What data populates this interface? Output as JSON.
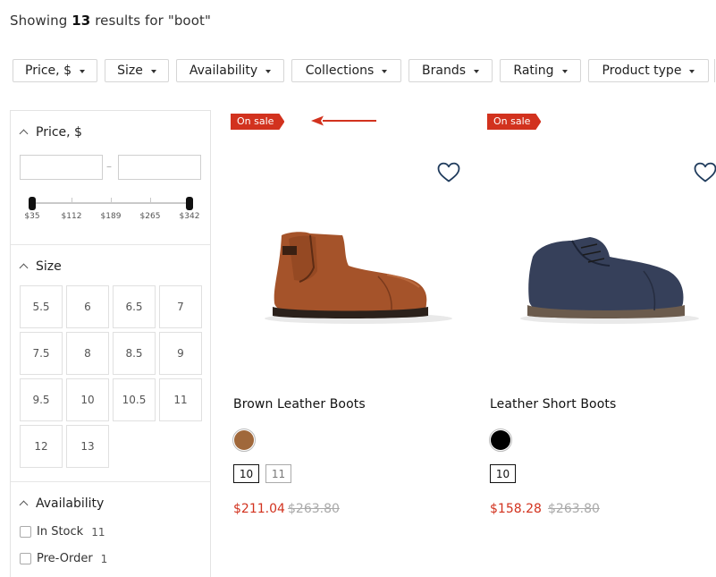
{
  "results": {
    "prefix": "Showing",
    "count": "13",
    "suffix": "results for \"boot\""
  },
  "filters": [
    "Price, $",
    "Size",
    "Availability",
    "Collections",
    "Brands",
    "Rating",
    "Product type"
  ],
  "sidebar": {
    "price": {
      "title": "Price, $",
      "dash": "–",
      "ticks": [
        "$35",
        "$112",
        "$189",
        "$265",
        "$342"
      ]
    },
    "size": {
      "title": "Size",
      "options": [
        "5.5",
        "6",
        "6.5",
        "7",
        "7.5",
        "8",
        "8.5",
        "9",
        "9.5",
        "10",
        "10.5",
        "11",
        "12",
        "13"
      ]
    },
    "availability": {
      "title": "Availability",
      "options": [
        {
          "label": "In Stock",
          "count": "11"
        },
        {
          "label": "Pre-Order",
          "count": "1"
        }
      ]
    }
  },
  "products": [
    {
      "badge": "On sale",
      "name": "Brown Leather Boots",
      "swatch_color": "#a0683b",
      "sizes": [
        {
          "label": "10",
          "selected": true
        },
        {
          "label": "11",
          "selected": false
        }
      ],
      "price": "$211.04",
      "original_price": "$263.80"
    },
    {
      "badge": "On sale",
      "name": "Leather Short Boots",
      "swatch_color": "#000000",
      "sizes": [
        {
          "label": "10",
          "selected": true
        }
      ],
      "price": "$158.28",
      "original_price": "$263.80"
    }
  ],
  "colors": {
    "accent_red": "#d2321e",
    "heart_navy": "#1f3b5c",
    "border": "#d6d6d6"
  },
  "icons": [
    "caret-down-icon",
    "chevron-up-icon",
    "heart-icon",
    "arrow-left-icon"
  ]
}
